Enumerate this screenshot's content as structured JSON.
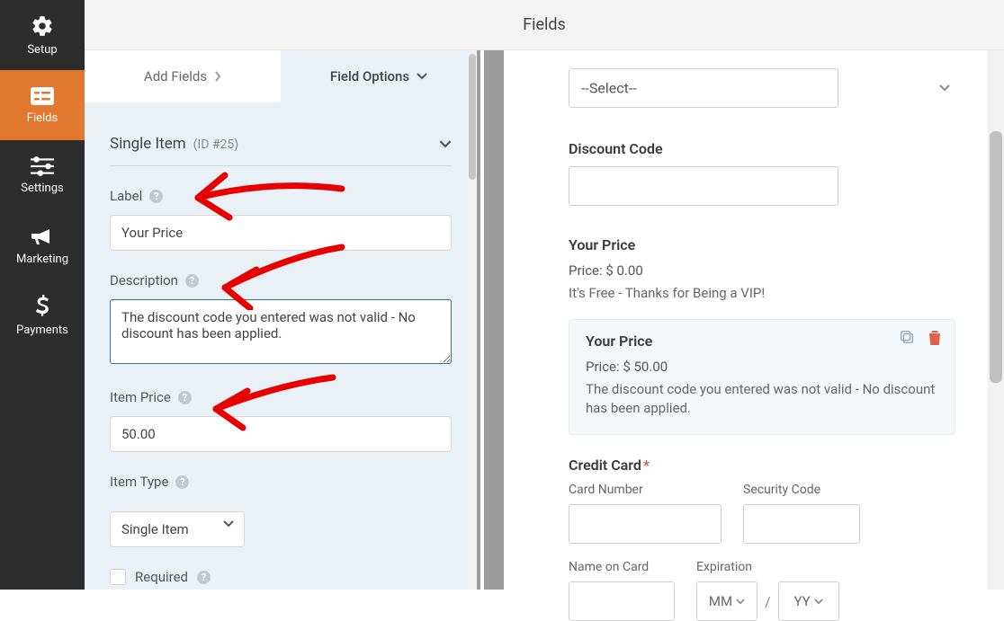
{
  "header": {
    "title": "Fields"
  },
  "sidebar": {
    "items": [
      {
        "label": "Setup"
      },
      {
        "label": "Fields"
      },
      {
        "label": "Settings"
      },
      {
        "label": "Marketing"
      },
      {
        "label": "Payments"
      }
    ]
  },
  "panel": {
    "tabs": {
      "add": "Add Fields",
      "opts": "Field Options"
    },
    "section_title": "Single Item",
    "section_sub": "(ID #25)",
    "label_label": "Label",
    "label_value": "Your Price",
    "desc_label": "Description",
    "desc_value": "The discount code you entered was not valid - No discount has been applied.",
    "price_label": "Item Price",
    "price_value": "50.00",
    "type_label": "Item Type",
    "type_value": "Single Item",
    "required_label": "Required"
  },
  "preview": {
    "select_placeholder": "--Select--",
    "discount_label": "Discount Code",
    "price1_label": "Your Price",
    "price1_line": "Price: $ 0.00",
    "price1_desc": "It's Free - Thanks for Being a VIP!",
    "price2_label": "Your Price",
    "price2_line": "Price: $ 50.00",
    "price2_desc": "The discount code you entered was not valid - No discount has been applied.",
    "cc_title": "Credit Card",
    "cc_number": "Card Number",
    "cc_security": "Security Code",
    "cc_name": "Name on Card",
    "cc_exp": "Expiration",
    "cc_mm": "MM",
    "cc_yy": "YY",
    "cc_sep": "/"
  }
}
